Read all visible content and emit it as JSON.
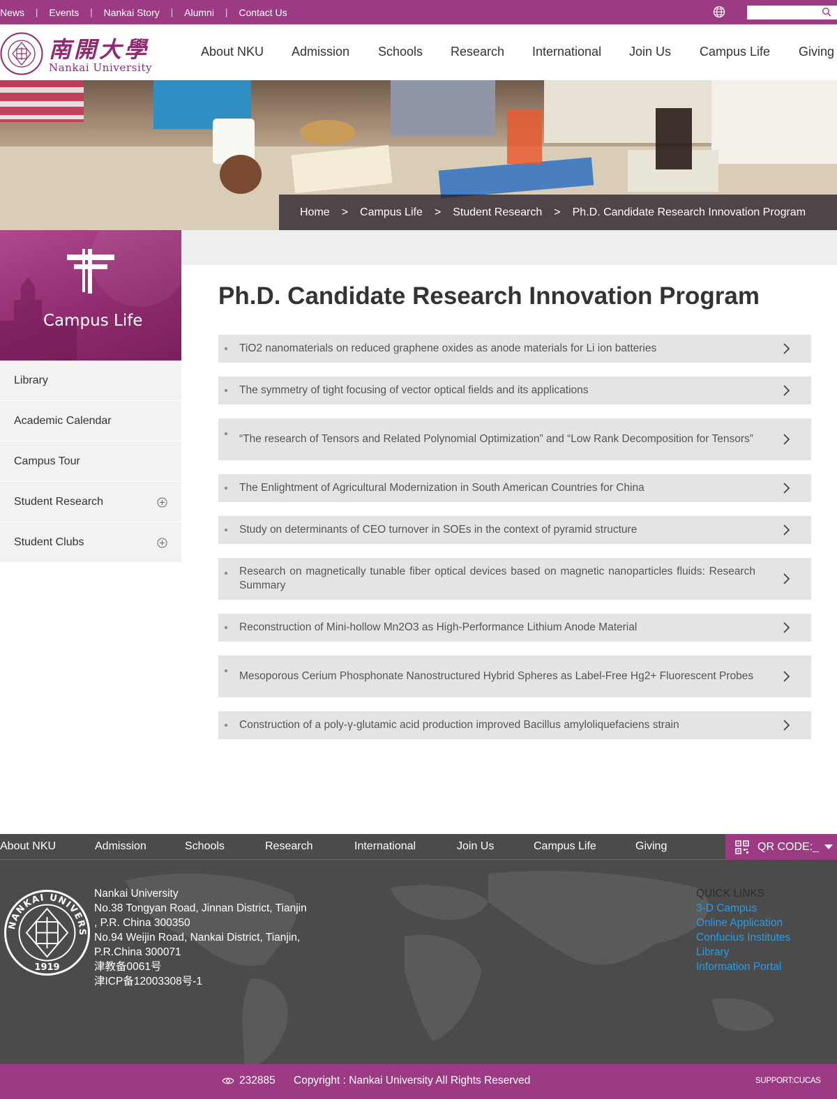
{
  "topbar": {
    "links": [
      "News",
      "Events",
      "Nankai Story",
      "Alumni",
      "Contact Us"
    ],
    "search": {
      "value": "",
      "placeholder": ""
    },
    "colors": {
      "brand": "#9c3b84"
    }
  },
  "header": {
    "logo_cn": "南開大學",
    "logo_en": "Nankai University",
    "seal_text": "NANKAI UNIVERSITY",
    "seal_year": "1919",
    "nav": [
      "About NKU",
      "Admission",
      "Schools",
      "Research",
      "International",
      "Join Us",
      "Campus Life",
      "Giving"
    ]
  },
  "breadcrumb": {
    "items": [
      "Home",
      "Campus Life",
      "Student Research",
      "Ph.D. Candidate Research Innovation Program"
    ],
    "separator": ">"
  },
  "sidebar": {
    "title": "Campus Life",
    "items": [
      {
        "label": "Library",
        "expandable": false
      },
      {
        "label": "Academic Calendar",
        "expandable": false
      },
      {
        "label": "Campus Tour",
        "expandable": false
      },
      {
        "label": "Student Research",
        "expandable": true
      },
      {
        "label": "Student Clubs",
        "expandable": true
      }
    ]
  },
  "main": {
    "title": "Ph.D. Candidate Research Innovation Program",
    "articles": [
      "TiO2 nanomaterials on reduced graphene oxides as anode materials for Li ion batteries",
      "The symmetry of tight focusing of vector optical fields and its applications",
      "“The research of Tensors and Related Polynomial Optimization” and “Low Rank Decomposition for Tensors”",
      "The Enlightment of Agricultural Modernization in South American Countries for China",
      "Study on determinants of CEO turnover in SOEs in the context of pyramid structure",
      "Research on magnetically tunable fiber optical devices based on magnetic nanoparticles fluids: Research Summary",
      "Reconstruction of Mini-hollow Mn2O3 as High-Performance Lithium Anode Material",
      "Mesoporous Cerium Phosphonate Nanostructured Hybrid Spheres as Label-Free Hg2+ Fluorescent Probes",
      "Construction of a poly-γ-glutamic acid production improved Bacillus amyloliquefaciens strain"
    ]
  },
  "footer": {
    "nav": [
      "About NKU",
      "Admission",
      "Schools",
      "Research",
      "International",
      "Join Us",
      "Campus Life",
      "Giving"
    ],
    "qr_label": "QR CODE:_",
    "address_lines": [
      "Nankai University",
      "No.38 Tongyan Road, Jinnan District, Tianjin",
      ", P.R. China 300350",
      "No.94 Weijin Road,  Nankai District, Tianjin,",
      "P.R.China  300071",
      "津教备0061号",
      "津ICP备12003308号-1"
    ],
    "quick_links_title": "QUICK LINKS",
    "quick_links": [
      "3-D Campus",
      "Online Application",
      "Confucius Institutes",
      "Library",
      "Information Portal"
    ],
    "visit_count": "232885",
    "copyright": "Copyright : Nankai University All Rights Reserved",
    "support": "SUPPORT:CUCAS"
  }
}
